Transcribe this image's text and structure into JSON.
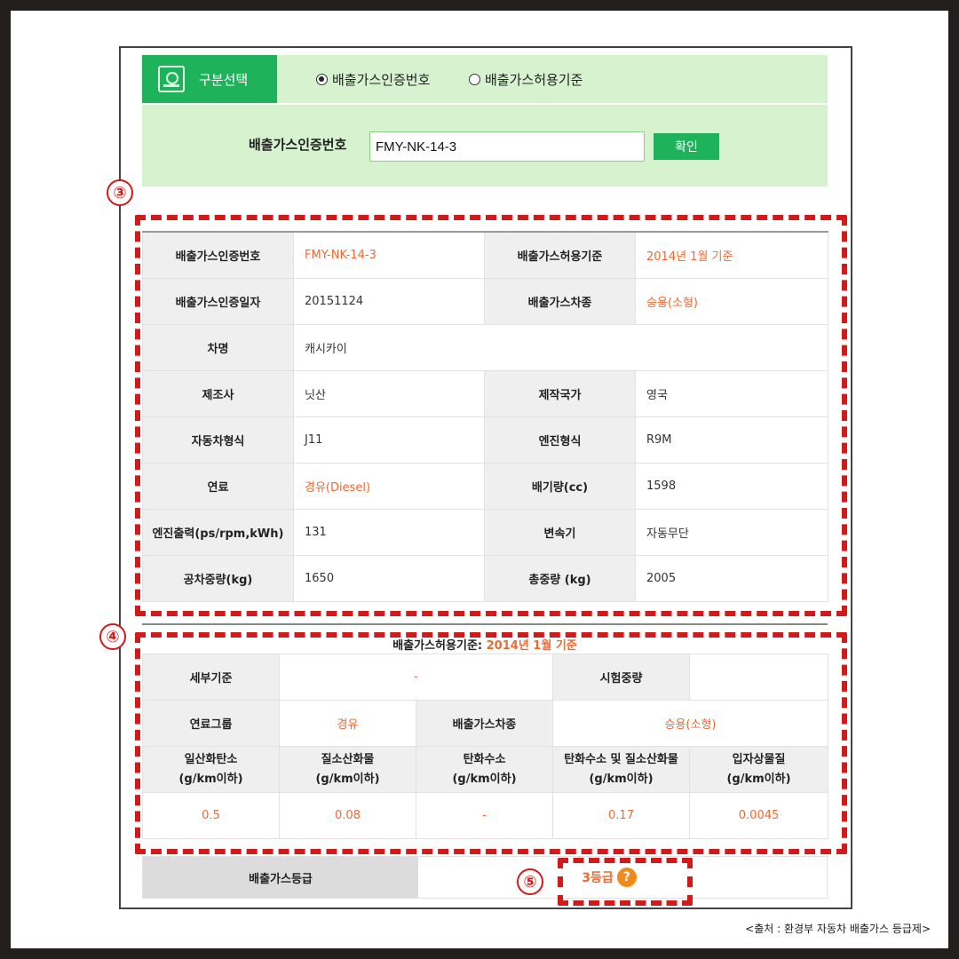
{
  "selector": {
    "tab_label": "구분선택",
    "option_cert": "배출가스인증번호",
    "option_standard": "배출가스허용기준",
    "selected": "option_cert"
  },
  "search": {
    "label": "배출가스인증번호",
    "value": "FMY-NK-14-3",
    "button": "확인"
  },
  "vehicle_info": {
    "cert_no_label": "배출가스인증번호",
    "cert_no": "FMY-NK-14-3",
    "standard_label": "배출가스허용기준",
    "standard": "2014년 1월 기준",
    "cert_date_label": "배출가스인증일자",
    "cert_date": "20151124",
    "vehicle_type_label": "배출가스차종",
    "vehicle_type": "승용(소형)",
    "name_label": "차명",
    "name": "캐시카이",
    "maker_label": "제조사",
    "maker": "닛산",
    "country_label": "제작국가",
    "country": "영국",
    "model_label": "자동차형식",
    "model": "J11",
    "engine_label": "엔진형식",
    "engine": "R9M",
    "fuel_label": "연료",
    "fuel": "경유(Diesel)",
    "displacement_label": "배기량(cc)",
    "displacement": "1598",
    "power_label": "엔진출력(ps/rpm,kWh)",
    "power": "131",
    "transmission_label": "변속기",
    "transmission": "자동무단",
    "curb_weight_label": "공차중량(kg)",
    "curb_weight": "1650",
    "gross_weight_label": "총중량 (kg)",
    "gross_weight": "2005"
  },
  "emission_standard": {
    "title_prefix": "배출가스허용기준:",
    "title_value": "2014년 1월 기준",
    "detail_label": "세부기준",
    "detail": "-",
    "test_weight_label": "시험중량",
    "test_weight": "",
    "fuel_group_label": "연료그룹",
    "fuel_group": "경유",
    "vehicle_type_label": "배출가스차종",
    "vehicle_type": "승용(소형)",
    "headers": [
      {
        "line1": "일산화탄소",
        "line2": "(g/km이하)"
      },
      {
        "line1": "질소산화물",
        "line2": "(g/km이하)"
      },
      {
        "line1": "탄화수소",
        "line2": "(g/km이하)"
      },
      {
        "line1": "탄화수소 및 질소산화물",
        "line2": "(g/km이하)"
      },
      {
        "line1": "입자상물질",
        "line2": "(g/km이하)"
      }
    ],
    "values": [
      "0.5",
      "0.08",
      "-",
      "0.17",
      "0.0045"
    ]
  },
  "grade": {
    "label": "배출가스등급",
    "value": "3등급",
    "help": "?"
  },
  "annotations": {
    "badge3": "③",
    "badge4": "④",
    "badge5": "⑤",
    "color": "#d11b1b"
  },
  "source": "<출처 : 환경부 자동차 배출가스 등급제>",
  "colors": {
    "accent_green": "#1eb25a",
    "light_green": "#d6f2cf",
    "orange_text": "#ef6a32"
  }
}
